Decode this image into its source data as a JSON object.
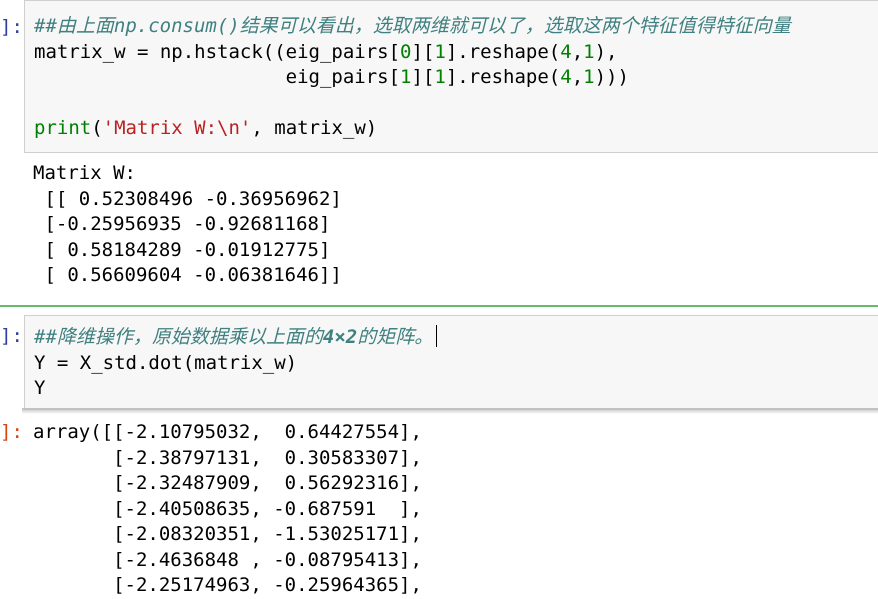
{
  "cell1": {
    "in_prompt": "]:",
    "comment": "##由上面np.consum()结果可以看出，选取两维就可以了，选取这两个特征值得特征向量",
    "line2_a": "matrix_w = np.hstack((eig_pairs[",
    "line2_b": "0",
    "line2_c": "][",
    "line2_d": "1",
    "line2_e": "].reshape(",
    "line2_f": "4",
    "line2_g": ",",
    "line2_h": "1",
    "line2_i": "),",
    "line3_a": "                      eig_pairs[",
    "line3_b": "1",
    "line3_c": "][",
    "line3_d": "1",
    "line3_e": "].reshape(",
    "line3_f": "4",
    "line3_g": ",",
    "line3_h": "1",
    "line3_i": ")))",
    "print_kw": "print",
    "print_b": "(",
    "print_str": "'Matrix W:\\n'",
    "print_c": ", matrix_w)",
    "output": "Matrix W:\n [[ 0.52308496 -0.36956962]\n [-0.25956935 -0.92681168]\n [ 0.58184289 -0.01912775]\n [ 0.56609604 -0.06381646]]"
  },
  "cell2": {
    "in_prompt": "]:",
    "comment_a": "##降维操作，原始数据乘以上面的",
    "comment_b": "4×2",
    "comment_c": "的矩阵。",
    "line2": "Y = X_std.dot(matrix_w)",
    "line3": "Y",
    "out_prompt": "]:",
    "output": "array([[-2.10795032,  0.64427554],\n       [-2.38797131,  0.30583307],\n       [-2.32487909,  0.56292316],\n       [-2.40508635, -0.687591  ],\n       [-2.08320351, -1.53025171],\n       [-2.4636848 , -0.08795413],\n       [-2.25174963, -0.25964365],"
  }
}
